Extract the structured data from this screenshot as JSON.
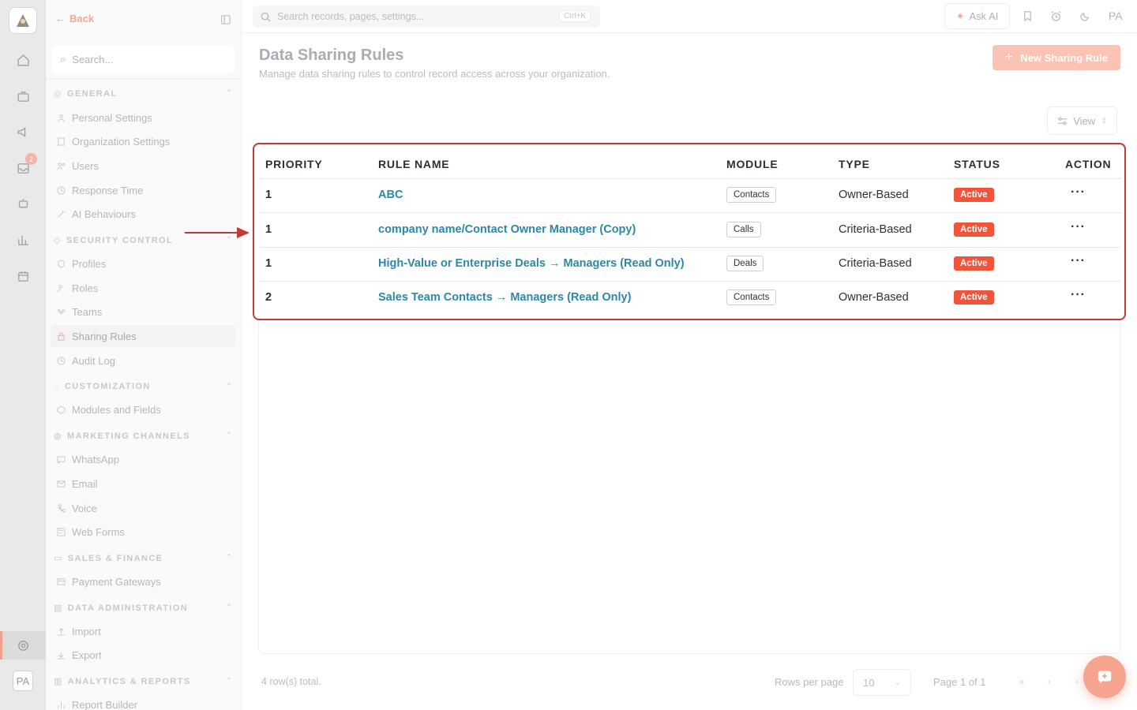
{
  "rail": {
    "badge_count": "2",
    "avatar": "PA",
    "icons": [
      "home-icon",
      "briefcase-icon",
      "megaphone-icon",
      "inbox-icon",
      "robot-icon",
      "chart-icon",
      "calendar-icon",
      "settings-icon"
    ]
  },
  "sidebar": {
    "back_label": "Back",
    "search_placeholder": "Search...",
    "sections": [
      {
        "title": "GENERAL",
        "items": [
          "Personal Settings",
          "Organization Settings",
          "Users",
          "Response Time",
          "AI Behaviours"
        ]
      },
      {
        "title": "SECURITY CONTROL",
        "items": [
          "Profiles",
          "Roles",
          "Teams",
          "Sharing Rules",
          "Audit Log"
        ]
      },
      {
        "title": "CUSTOMIZATION",
        "items": [
          "Modules and Fields"
        ]
      },
      {
        "title": "MARKETING CHANNELS",
        "items": [
          "WhatsApp",
          "Email",
          "Voice",
          "Web Forms"
        ]
      },
      {
        "title": "SALES & FINANCE",
        "items": [
          "Payment Gateways"
        ]
      },
      {
        "title": "DATA ADMINISTRATION",
        "items": [
          "Import",
          "Export"
        ]
      },
      {
        "title": "ANALYTICS & REPORTS",
        "items": [
          "Report Builder"
        ]
      }
    ]
  },
  "topbar": {
    "search_placeholder": "Search records, pages, settings...",
    "shortcut": "Ctrl+K",
    "ask_ai": "Ask AI",
    "user_initials": "PA"
  },
  "page": {
    "title": "Data Sharing Rules",
    "subtitle": "Manage data sharing rules to control record access across your organization.",
    "new_button": "New Sharing Rule",
    "view_button": "View"
  },
  "table": {
    "columns": [
      "PRIORITY",
      "RULE NAME",
      "MODULE",
      "TYPE",
      "STATUS",
      "ACTION"
    ],
    "rows": [
      {
        "priority": "1",
        "name": "ABC",
        "module": "Contacts",
        "type": "Owner-Based",
        "status": "Active",
        "action": "···"
      },
      {
        "priority": "1",
        "name": "company name/Contact Owner Manager (Copy)",
        "module": "Calls",
        "type": "Criteria-Based",
        "status": "Active",
        "action": "···"
      },
      {
        "priority": "1",
        "name": "High-Value or Enterprise Deals → Managers (Read Only)",
        "module": "Deals",
        "type": "Criteria-Based",
        "status": "Active",
        "action": "···"
      },
      {
        "priority": "2",
        "name": "Sales Team Contacts → Managers (Read Only)",
        "module": "Contacts",
        "type": "Owner-Based",
        "status": "Active",
        "action": "···"
      }
    ]
  },
  "footer": {
    "total": "4 row(s) total.",
    "rows_per_page_label": "Rows per page",
    "rows_per_page_value": "10",
    "page_label": "Page 1 of 1"
  },
  "colors": {
    "accent": "#f2543b",
    "link": "#2d87a7",
    "highlight_border": "#c23a36"
  }
}
